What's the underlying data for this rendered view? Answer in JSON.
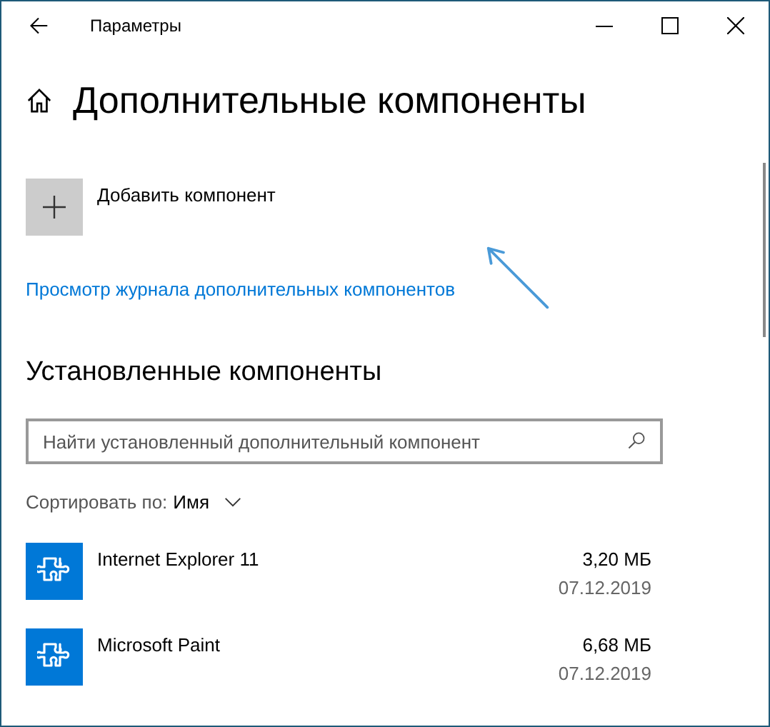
{
  "window": {
    "title": "Параметры"
  },
  "page_title": "Дополнительные компоненты",
  "add_button": {
    "label": "Добавить компонент"
  },
  "history_link": "Просмотр журнала дополнительных компонентов",
  "installed": {
    "heading": "Установленные компоненты",
    "search": {
      "placeholder": "Найти установленный дополнительный компонент"
    },
    "sort": {
      "label": "Сортировать по:",
      "value": "Имя"
    },
    "items": [
      {
        "name": "Internet Explorer 11",
        "size": "3,20 МБ",
        "date": "07.12.2019"
      },
      {
        "name": "Microsoft Paint",
        "size": "6,68 МБ",
        "date": "07.12.2019"
      }
    ]
  }
}
